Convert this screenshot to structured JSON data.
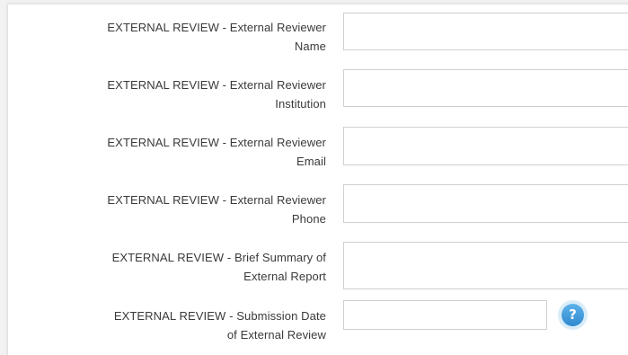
{
  "form": {
    "fields": [
      {
        "line1": "EXTERNAL REVIEW - External Reviewer",
        "line2": "Name",
        "value": ""
      },
      {
        "line1": "EXTERNAL REVIEW - External Reviewer",
        "line2": "Institution",
        "value": ""
      },
      {
        "line1": "EXTERNAL REVIEW - External Reviewer",
        "line2": "Email",
        "value": ""
      },
      {
        "line1": "EXTERNAL REVIEW - External Reviewer",
        "line2": "Phone",
        "value": ""
      },
      {
        "line1": "EXTERNAL REVIEW - Brief Summary of",
        "line2": "External Report",
        "value": ""
      },
      {
        "line1": "EXTERNAL REVIEW - Submission Date",
        "line2": "of External Review",
        "value": ""
      }
    ],
    "help": {
      "glyph": "?",
      "icon": "help-icon"
    }
  },
  "colors": {
    "label": "#3a3a3a",
    "border": "#cfcfcf",
    "help": "#3a97db"
  }
}
